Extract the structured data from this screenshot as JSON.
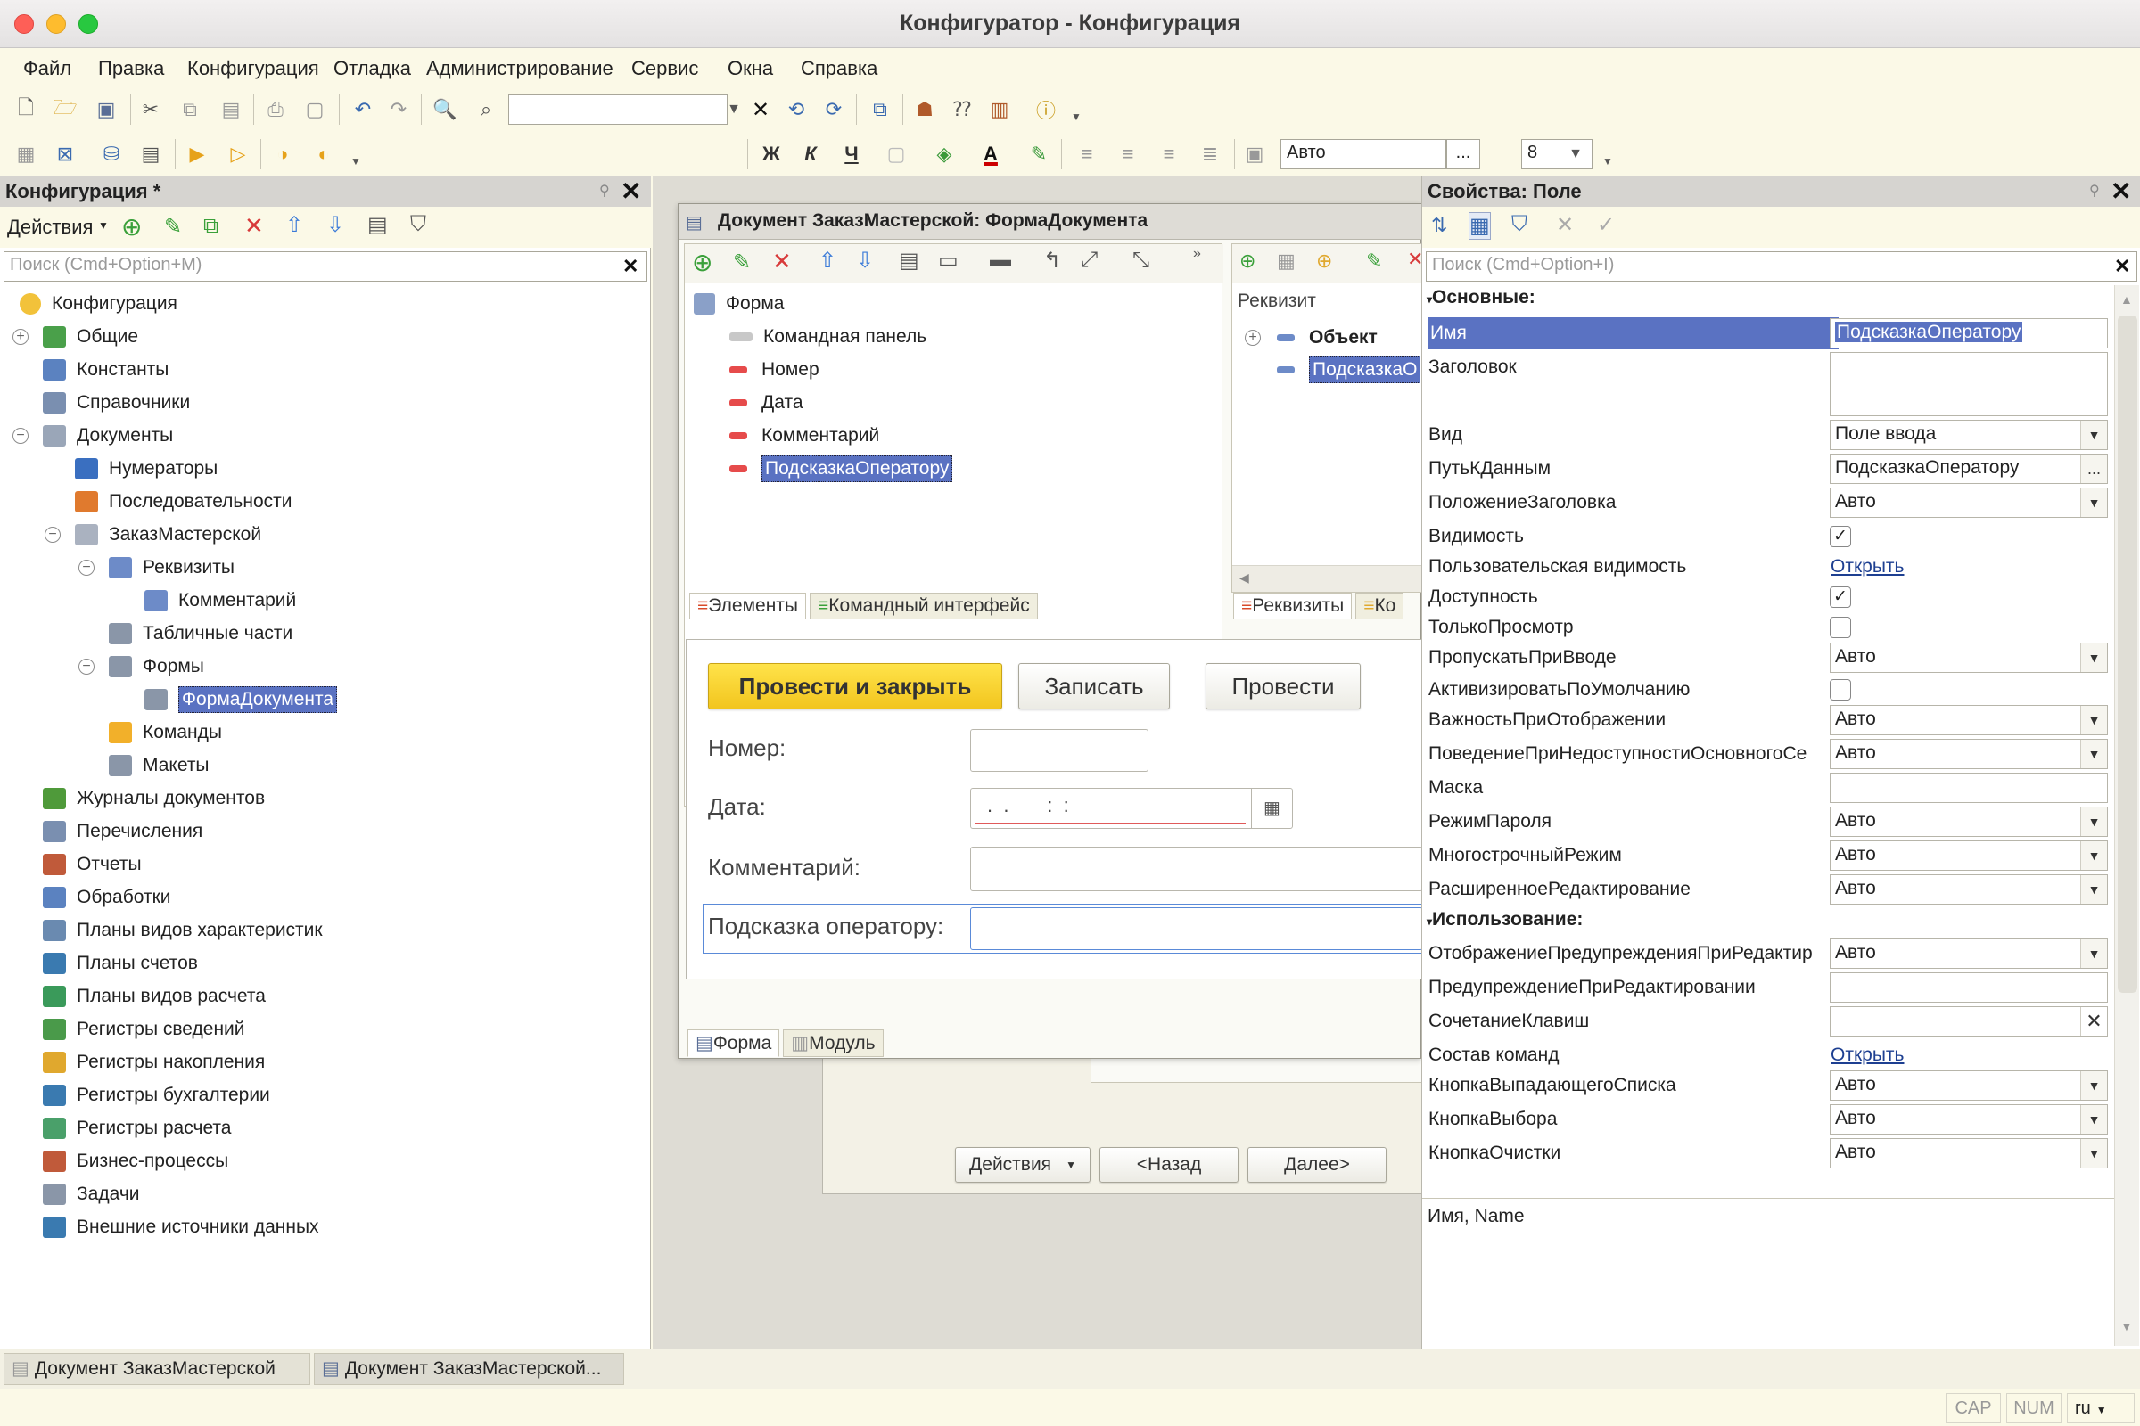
{
  "window": {
    "title": "Конфигуратор - Конфигурация"
  },
  "menu": [
    "Файл",
    "Правка",
    "Конфигурация",
    "Отладка",
    "Администрирование",
    "Сервис",
    "Окна",
    "Справка"
  ],
  "format_toolbar": {
    "font_value": "Авто",
    "size_value": "8",
    "bold": "Ж",
    "italic": "К",
    "underline": "Ч"
  },
  "left_panel": {
    "title": "Конфигурация *",
    "actions_label": "Действия",
    "search_placeholder": "Поиск (Cmd+Option+M)",
    "tree": [
      {
        "label": "Конфигурация",
        "color": "#f2c23a"
      },
      {
        "label": "Общие",
        "color": "#4aa04a"
      },
      {
        "label": "Константы",
        "color": "#5b82c0"
      },
      {
        "label": "Справочники",
        "color": "#7a8fb0"
      },
      {
        "label": "Документы",
        "color": "#9aa6b8"
      },
      {
        "label": "Нумераторы",
        "color": "#3a6fc0"
      },
      {
        "label": "Последовательности",
        "color": "#e07a2e"
      },
      {
        "label": "ЗаказМастерской",
        "color": "#aab2c0"
      },
      {
        "label": "Реквизиты",
        "color": "#6d8bc8"
      },
      {
        "label": "Комментарий",
        "color": "#6d8bc8"
      },
      {
        "label": "Табличные части",
        "color": "#8a96a8"
      },
      {
        "label": "Формы",
        "color": "#8a96a8"
      },
      {
        "label": "ФормаДокумента",
        "color": "#8a96a8"
      },
      {
        "label": "Команды",
        "color": "#f2b02a"
      },
      {
        "label": "Макеты",
        "color": "#8a96a8"
      },
      {
        "label": "Журналы документов",
        "color": "#4f9a3a"
      },
      {
        "label": "Перечисления",
        "color": "#7a8fb0"
      },
      {
        "label": "Отчеты",
        "color": "#c05a3a"
      },
      {
        "label": "Обработки",
        "color": "#5b82c0"
      },
      {
        "label": "Планы видов характеристик",
        "color": "#6a8ab0"
      },
      {
        "label": "Планы счетов",
        "color": "#3a7ab0"
      },
      {
        "label": "Планы видов расчета",
        "color": "#3a9a5a"
      },
      {
        "label": "Регистры сведений",
        "color": "#4a9a4a"
      },
      {
        "label": "Регистры накопления",
        "color": "#e0a82e"
      },
      {
        "label": "Регистры бухгалтерии",
        "color": "#3a7ab0"
      },
      {
        "label": "Регистры расчета",
        "color": "#4aa06a"
      },
      {
        "label": "Бизнес-процессы",
        "color": "#c05a3a"
      },
      {
        "label": "Задачи",
        "color": "#8a96a8"
      },
      {
        "label": "Внешние источники данных",
        "color": "#3a7ab0"
      }
    ]
  },
  "doc_window": {
    "title": "Документ ЗаказМастерской: ФормаДокумента",
    "elements_tree": [
      {
        "label": "Форма"
      },
      {
        "label": "Командная панель"
      },
      {
        "label": "Номер"
      },
      {
        "label": "Дата"
      },
      {
        "label": "Комментарий"
      },
      {
        "label": "ПодсказкаОператору"
      }
    ],
    "attributes_header": "Реквизит",
    "attributes_tree": [
      {
        "label": "Объект"
      },
      {
        "label": "ПодсказкаО"
      }
    ],
    "left_tabs": [
      "Элементы",
      "Командный интерфейс"
    ],
    "right_tabs": [
      "Реквизиты",
      "Ко"
    ],
    "preview": {
      "btn_post_close": "Провести и закрыть",
      "btn_save": "Записать",
      "btn_post": "Провести",
      "label_number": "Номер:",
      "label_date": "Дата:",
      "date_mask": ".  .       :  :",
      "label_comment": "Комментарий:",
      "label_hint": "Подсказка оператору:"
    },
    "bottom_tabs": [
      "Форма",
      "Модуль"
    ]
  },
  "back_dialog": {
    "actions": "Действия",
    "back": "<Назад",
    "next": "Далее>"
  },
  "properties": {
    "title": "Свойства: Поле",
    "search_placeholder": "Поиск (Cmd+Option+I)",
    "group_main": "Основные:",
    "group_usage": "Использование:",
    "rows": [
      {
        "name": "Имя",
        "value": "ПодсказкаОператору",
        "type": "text"
      },
      {
        "name": "Заголовок",
        "value": "",
        "type": "multiline"
      },
      {
        "name": "Вид",
        "value": "Поле ввода",
        "type": "dropdown"
      },
      {
        "name": "ПутьКДанным",
        "value": "ПодсказкаОператору",
        "type": "select"
      },
      {
        "name": "ПоложениеЗаголовка",
        "value": "Авто",
        "type": "dropdown"
      },
      {
        "name": "Видимость",
        "value": "✓",
        "type": "check"
      },
      {
        "name": "Пользовательская видимость",
        "value": "Открыть",
        "type": "link"
      },
      {
        "name": "Доступность",
        "value": "✓",
        "type": "check"
      },
      {
        "name": "ТолькоПросмотр",
        "value": "",
        "type": "check"
      },
      {
        "name": "ПропускатьПриВводе",
        "value": "Авто",
        "type": "dropdown"
      },
      {
        "name": "АктивизироватьПоУмолчанию",
        "value": "",
        "type": "check"
      },
      {
        "name": "ВажностьПриОтображении",
        "value": "Авто",
        "type": "dropdown"
      },
      {
        "name": "ПоведениеПриНедоступностиОсновногоСе",
        "value": "Авто",
        "type": "dropdown"
      },
      {
        "name": "Маска",
        "value": "",
        "type": "text"
      },
      {
        "name": "РежимПароля",
        "value": "Авто",
        "type": "dropdown"
      },
      {
        "name": "МногострочныйРежим",
        "value": "Авто",
        "type": "dropdown"
      },
      {
        "name": "РасширенноеРедактирование",
        "value": "Авто",
        "type": "dropdown"
      },
      {
        "name": "ОтображениеПредупрежденияПриРедактир",
        "value": "Авто",
        "type": "dropdown"
      },
      {
        "name": "ПредупреждениеПриРедактировании",
        "value": "",
        "type": "text"
      },
      {
        "name": "СочетаниеКлавиш",
        "value": "",
        "type": "clear"
      },
      {
        "name": "Состав команд",
        "value": "Открыть",
        "type": "link"
      },
      {
        "name": "КнопкаВыпадающегоСписка",
        "value": "Авто",
        "type": "dropdown"
      },
      {
        "name": "КнопкаВыбора",
        "value": "Авто",
        "type": "dropdown"
      },
      {
        "name": "КнопкаОчистки",
        "value": "Авто",
        "type": "dropdown"
      }
    ],
    "description": "Имя, Name"
  },
  "taskbar": [
    "Документ ЗаказМастерской",
    "Документ ЗаказМастерской..."
  ],
  "status": {
    "caps": "CAP",
    "num": "NUM",
    "lang": "ru"
  }
}
